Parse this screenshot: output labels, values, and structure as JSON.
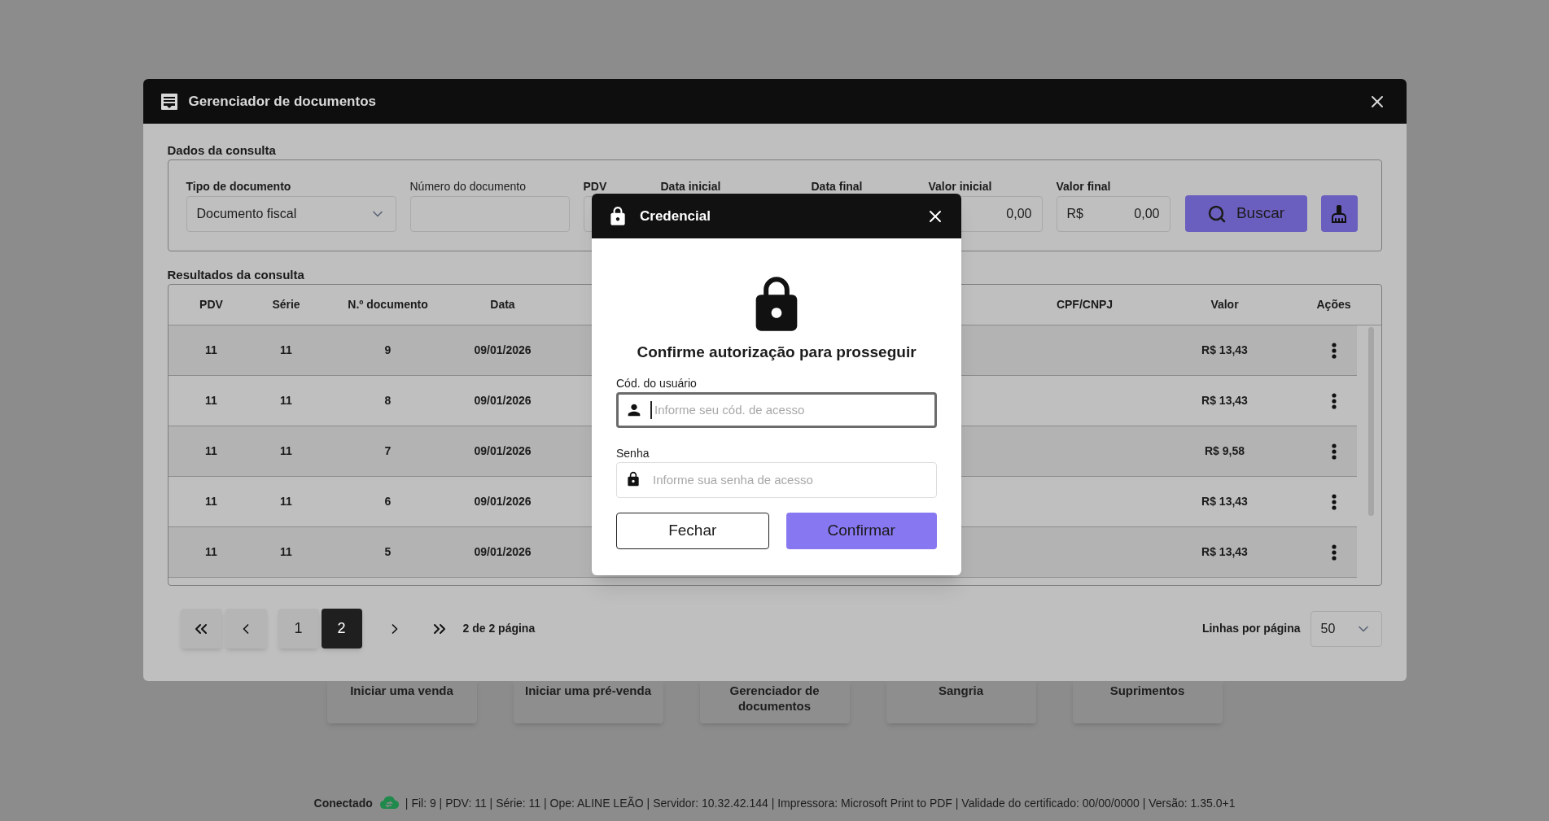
{
  "window": {
    "title": "Gerenciador de documentos"
  },
  "query": {
    "title": "Dados da consulta",
    "fields": [
      {
        "kind": "select",
        "label": "Tipo de documento",
        "value": "Documento fiscal"
      },
      {
        "kind": "text",
        "label": "Número do documento"
      },
      {
        "kind": "edge",
        "label": "PDV"
      },
      {
        "kind": "covered",
        "label": "Data inicial"
      },
      {
        "kind": "covered",
        "label": "Data final"
      },
      {
        "kind": "money",
        "label": "Valor inicial",
        "value": "0,00"
      },
      {
        "kind": "money",
        "label": "Valor final",
        "prefix": "R$",
        "value": "0,00"
      }
    ],
    "search_button": "Buscar"
  },
  "results": {
    "title": "Resultados da consulta",
    "columns": [
      "PDV",
      "Série",
      "N.º documento",
      "Data",
      "CPF/CNPJ",
      "Valor",
      "Ações"
    ],
    "rows": [
      {
        "pdv": "11",
        "serie": "11",
        "numero": "9",
        "data": "09/01/2026",
        "valor": "R$ 13,43"
      },
      {
        "pdv": "11",
        "serie": "11",
        "numero": "8",
        "data": "09/01/2026",
        "valor": "R$ 13,43"
      },
      {
        "pdv": "11",
        "serie": "11",
        "numero": "7",
        "data": "09/01/2026",
        "valor": "R$ 9,58"
      },
      {
        "pdv": "11",
        "serie": "11",
        "numero": "6",
        "data": "09/01/2026",
        "valor": "R$ 13,43"
      },
      {
        "pdv": "11",
        "serie": "11",
        "numero": "5",
        "data": "09/01/2026",
        "valor": "R$ 13,43"
      }
    ]
  },
  "pagination": {
    "pages": [
      {
        "label": "1",
        "selected": false
      },
      {
        "label": "2",
        "selected": true
      }
    ],
    "info": "2 de 2 página",
    "rows_per_page_label": "Linhas por página",
    "rows_per_page": "50"
  },
  "modal": {
    "title": "Credencial",
    "heading": "Confirme autorização para prosseguir",
    "fields": [
      {
        "kind": "user",
        "label": "Cód. do usuário",
        "placeholder": "Informe seu cód. de acesso",
        "focused": true
      },
      {
        "kind": "password",
        "label": "Senha",
        "placeholder": "Informe sua senha de acesso",
        "focused": false
      }
    ],
    "buttons": [
      {
        "kind": "secondary",
        "label": "Fechar"
      },
      {
        "kind": "primary",
        "label": "Confirmar"
      }
    ]
  },
  "tiles": [
    "Iniciar uma venda",
    "Iniciar uma pré-venda",
    "Gerenciador de documentos",
    "Sangria",
    "Suprimentos"
  ],
  "status_bar": {
    "connection": "Conectado",
    "details": "| Fil: 9 | PDV: 11 | Série: 11 | Ope: ALINE LEÃO | Servidor: 10.32.42.144 | Impressora: Microsoft Print to PDF | Validade do certificado: 00/00/0000 | Versão: 1.35.0+1"
  }
}
